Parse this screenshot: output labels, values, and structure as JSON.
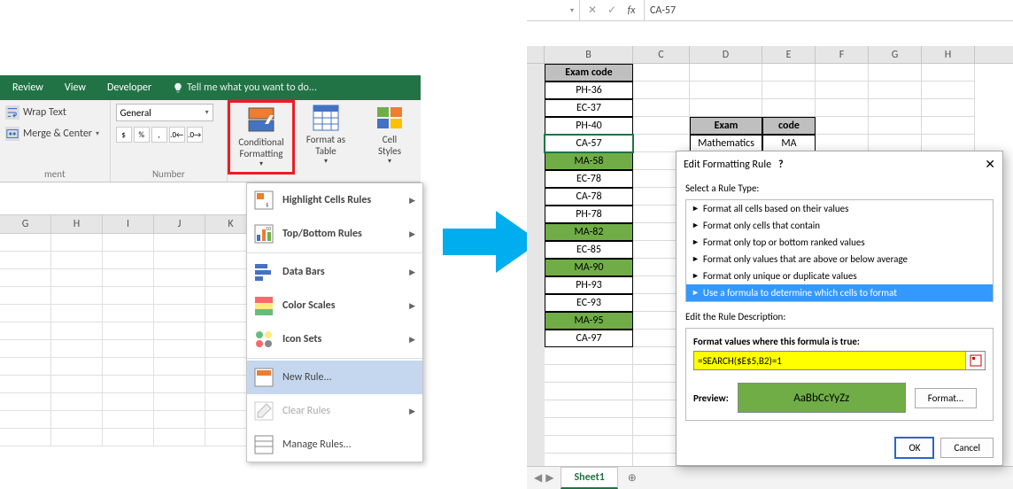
{
  "ribbon": {
    "tabs": [
      "Review",
      "View",
      "Developer"
    ],
    "tell_me": "Tell me what you want to do...",
    "alignment": {
      "wrap_text": "Wrap Text",
      "merge_center": "Merge & Center",
      "group_label": "ment"
    },
    "number": {
      "format": "General",
      "group_label": "Number"
    },
    "styles": {
      "conditional_formatting": "Conditional\nFormatting",
      "format_as_table": "Format as\nTable",
      "cell_styles": "Cell\nStyles"
    }
  },
  "cf_menu": {
    "items": [
      "Highlight Cells Rules",
      "Top/Bottom Rules",
      "Data Bars",
      "Color Scales",
      "Icon Sets",
      "New Rule...",
      "Clear Rules",
      "Manage Rules..."
    ]
  },
  "left_columns": [
    "G",
    "H",
    "I",
    "J",
    "K"
  ],
  "formula_bar": {
    "value": "CA-57",
    "fx": "fx"
  },
  "right_columns": [
    "B",
    "C",
    "D",
    "E",
    "F",
    "G",
    "H"
  ],
  "col_widths": {
    "B": 100,
    "C": 64,
    "D": 82,
    "E": 60,
    "F": 60,
    "G": 60,
    "H": 60
  },
  "exam_header": "Exam code",
  "exam_rows": [
    {
      "v": "PH-36",
      "g": false
    },
    {
      "v": "EC-37",
      "g": false
    },
    {
      "v": "PH-40",
      "g": false
    },
    {
      "v": "CA-57",
      "g": false,
      "sel": true
    },
    {
      "v": "MA-58",
      "g": true
    },
    {
      "v": "EC-78",
      "g": false
    },
    {
      "v": "CA-78",
      "g": false
    },
    {
      "v": "PH-78",
      "g": false
    },
    {
      "v": "MA-82",
      "g": true
    },
    {
      "v": "EC-85",
      "g": false
    },
    {
      "v": "MA-90",
      "g": true
    },
    {
      "v": "PH-93",
      "g": false
    },
    {
      "v": "EC-93",
      "g": false
    },
    {
      "v": "MA-95",
      "g": true
    },
    {
      "v": "CA-97",
      "g": false
    }
  ],
  "lookup": {
    "h1": "Exam",
    "h2": "code",
    "v1": "Mathematics",
    "v2": "MA"
  },
  "dialog": {
    "title": "Edit Formatting Rule",
    "select_label": "Select a Rule Type:",
    "rules": [
      "Format all cells based on their values",
      "Format only cells that contain",
      "Format only top or bottom ranked values",
      "Format only values that are above or below average",
      "Format only unique or duplicate values",
      "Use a formula to determine which cells to format"
    ],
    "edit_label": "Edit the Rule Description:",
    "formula_label": "Format values where this formula is true:",
    "formula": "=SEARCH($E$5,B2)=1",
    "preview_label": "Preview:",
    "preview_text": "AaBbCcYyZz",
    "format_btn": "Format...",
    "ok": "OK",
    "cancel": "Cancel"
  },
  "sheet_tab": "Sheet1"
}
